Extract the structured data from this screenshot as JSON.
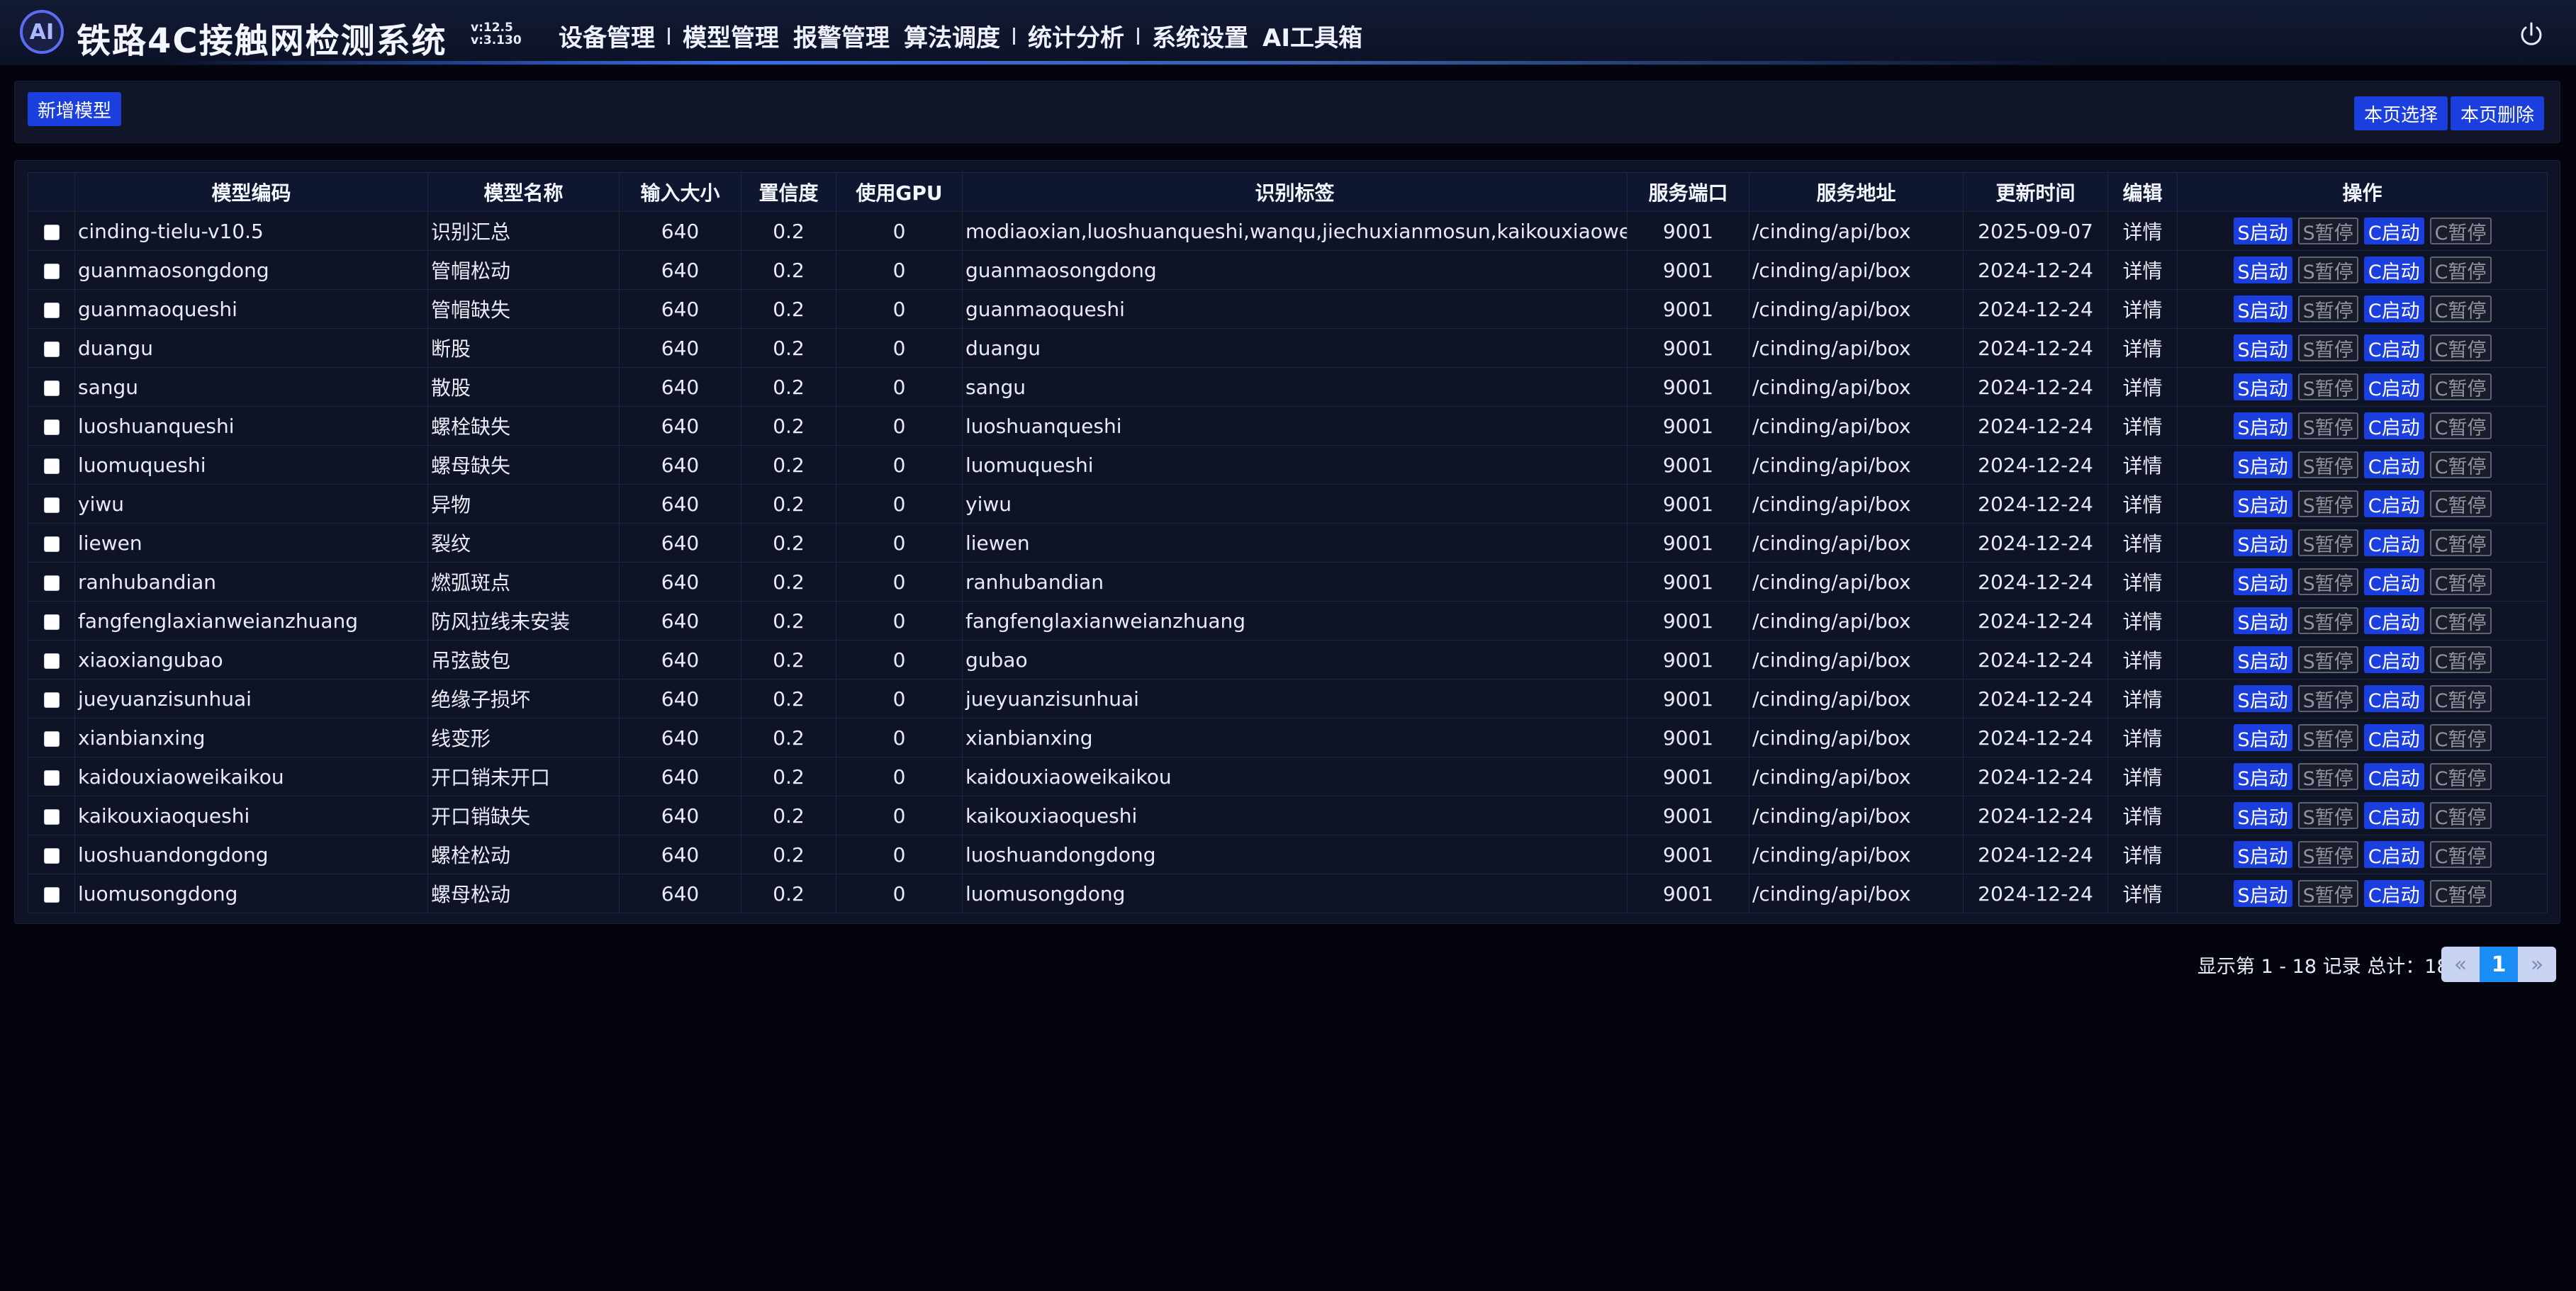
{
  "header": {
    "logo_text": "AI",
    "title": "铁路4C接触网检测系统",
    "version_lines": [
      "v:12.5",
      "v:3.130"
    ],
    "nav": [
      "设备管理",
      "模型管理",
      "报警管理",
      "算法调度",
      "统计分析",
      "系统设置",
      "AI工具箱"
    ],
    "power_icon": "power-icon"
  },
  "toolbar": {
    "add_label": "新增模型",
    "select_page_label": "本页选择",
    "delete_page_label": "本页删除"
  },
  "table": {
    "columns": [
      "模型编码",
      "模型名称",
      "输入大小",
      "置信度",
      "使用GPU",
      "识别标签",
      "服务端口",
      "服务地址",
      "更新时间",
      "编辑",
      "操作"
    ],
    "edit_label": "详情",
    "op_labels": [
      "S启动",
      "S暂停",
      "C启动",
      "C暂停"
    ],
    "rows": [
      {
        "code": "cinding-tielu-v10.5",
        "name": "识别汇总",
        "input": "640",
        "conf": "0.2",
        "gpu": "0",
        "labels": "modiaoxian,luoshuanqueshi,wanqu,jiechuxianmosun,kaikouxiaoweikaikou",
        "port": "9001",
        "addr": "/cinding/api/box",
        "time": "2025-09-07"
      },
      {
        "code": "guanmaosongdong",
        "name": "管帽松动",
        "input": "640",
        "conf": "0.2",
        "gpu": "0",
        "labels": "guanmaosongdong",
        "port": "9001",
        "addr": "/cinding/api/box",
        "time": "2024-12-24"
      },
      {
        "code": "guanmaoqueshi",
        "name": "管帽缺失",
        "input": "640",
        "conf": "0.2",
        "gpu": "0",
        "labels": "guanmaoqueshi",
        "port": "9001",
        "addr": "/cinding/api/box",
        "time": "2024-12-24"
      },
      {
        "code": "duangu",
        "name": "断股",
        "input": "640",
        "conf": "0.2",
        "gpu": "0",
        "labels": "duangu",
        "port": "9001",
        "addr": "/cinding/api/box",
        "time": "2024-12-24"
      },
      {
        "code": "sangu",
        "name": "散股",
        "input": "640",
        "conf": "0.2",
        "gpu": "0",
        "labels": "sangu",
        "port": "9001",
        "addr": "/cinding/api/box",
        "time": "2024-12-24"
      },
      {
        "code": "luoshuanqueshi",
        "name": "螺栓缺失",
        "input": "640",
        "conf": "0.2",
        "gpu": "0",
        "labels": "luoshuanqueshi",
        "port": "9001",
        "addr": "/cinding/api/box",
        "time": "2024-12-24"
      },
      {
        "code": "luomuqueshi",
        "name": "螺母缺失",
        "input": "640",
        "conf": "0.2",
        "gpu": "0",
        "labels": "luomuqueshi",
        "port": "9001",
        "addr": "/cinding/api/box",
        "time": "2024-12-24"
      },
      {
        "code": "yiwu",
        "name": "异物",
        "input": "640",
        "conf": "0.2",
        "gpu": "0",
        "labels": "yiwu",
        "port": "9001",
        "addr": "/cinding/api/box",
        "time": "2024-12-24"
      },
      {
        "code": "liewen",
        "name": "裂纹",
        "input": "640",
        "conf": "0.2",
        "gpu": "0",
        "labels": "liewen",
        "port": "9001",
        "addr": "/cinding/api/box",
        "time": "2024-12-24"
      },
      {
        "code": "ranhubandian",
        "name": "燃弧斑点",
        "input": "640",
        "conf": "0.2",
        "gpu": "0",
        "labels": "ranhubandian",
        "port": "9001",
        "addr": "/cinding/api/box",
        "time": "2024-12-24"
      },
      {
        "code": "fangfenglaxianweianzhuang",
        "name": "防风拉线未安装",
        "input": "640",
        "conf": "0.2",
        "gpu": "0",
        "labels": "fangfenglaxianweianzhuang",
        "port": "9001",
        "addr": "/cinding/api/box",
        "time": "2024-12-24"
      },
      {
        "code": "xiaoxiangubao",
        "name": "吊弦鼓包",
        "input": "640",
        "conf": "0.2",
        "gpu": "0",
        "labels": "gubao",
        "port": "9001",
        "addr": "/cinding/api/box",
        "time": "2024-12-24"
      },
      {
        "code": "jueyuanzisunhuai",
        "name": "绝缘子损坏",
        "input": "640",
        "conf": "0.2",
        "gpu": "0",
        "labels": "jueyuanzisunhuai",
        "port": "9001",
        "addr": "/cinding/api/box",
        "time": "2024-12-24"
      },
      {
        "code": "xianbianxing",
        "name": "线变形",
        "input": "640",
        "conf": "0.2",
        "gpu": "0",
        "labels": "xianbianxing",
        "port": "9001",
        "addr": "/cinding/api/box",
        "time": "2024-12-24"
      },
      {
        "code": "kaidouxiaoweikaikou",
        "name": "开口销未开口",
        "input": "640",
        "conf": "0.2",
        "gpu": "0",
        "labels": "kaidouxiaoweikaikou",
        "port": "9001",
        "addr": "/cinding/api/box",
        "time": "2024-12-24"
      },
      {
        "code": "kaikouxiaoqueshi",
        "name": "开口销缺失",
        "input": "640",
        "conf": "0.2",
        "gpu": "0",
        "labels": "kaikouxiaoqueshi",
        "port": "9001",
        "addr": "/cinding/api/box",
        "time": "2024-12-24"
      },
      {
        "code": "luoshuandongdong",
        "name": "螺栓松动",
        "input": "640",
        "conf": "0.2",
        "gpu": "0",
        "labels": "luoshuandongdong",
        "port": "9001",
        "addr": "/cinding/api/box",
        "time": "2024-12-24"
      },
      {
        "code": "luomusongdong",
        "name": "螺母松动",
        "input": "640",
        "conf": "0.2",
        "gpu": "0",
        "labels": "luomusongdong",
        "port": "9001",
        "addr": "/cinding/api/box",
        "time": "2024-12-24"
      }
    ]
  },
  "pagination": {
    "info": "显示第 1 - 18 记录 总计：18",
    "prev": "«",
    "current": "1",
    "next": "»"
  },
  "colors": {
    "accent": "#1b3ede",
    "page_active": "#1a8ef6",
    "background": "#04040f"
  }
}
